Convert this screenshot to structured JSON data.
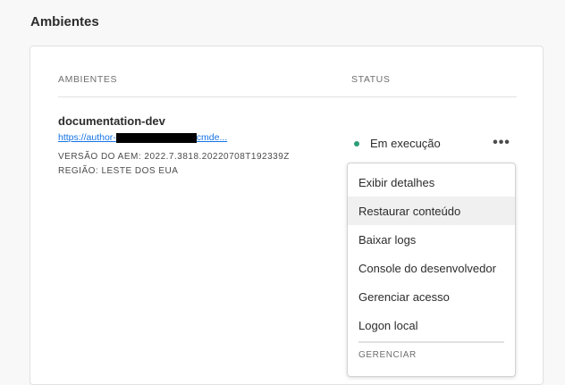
{
  "page": {
    "title": "Ambientes"
  },
  "table": {
    "headers": {
      "environments": "AMBIENTES",
      "status": "STATUS"
    },
    "row": {
      "name": "documentation-dev",
      "link_prefix": "https://author-",
      "link_suffix": "cmde...",
      "version": "VERSÃO DO AEM: 2022.7.3818.20220708T192339Z",
      "region": "REGIÃO: LESTE DOS EUA",
      "status": "Em execução",
      "status_color": "#2d9d78",
      "more_icon": "ellipsis-horizontal-icon"
    }
  },
  "menu": {
    "items": [
      {
        "label": "Exibir detalhes"
      },
      {
        "label": "Restaurar conteúdo"
      },
      {
        "label": "Baixar logs"
      },
      {
        "label": "Console do desenvolvedor"
      },
      {
        "label": "Gerenciar acesso"
      },
      {
        "label": "Logon local"
      }
    ],
    "section_label": "GERENCIAR"
  }
}
